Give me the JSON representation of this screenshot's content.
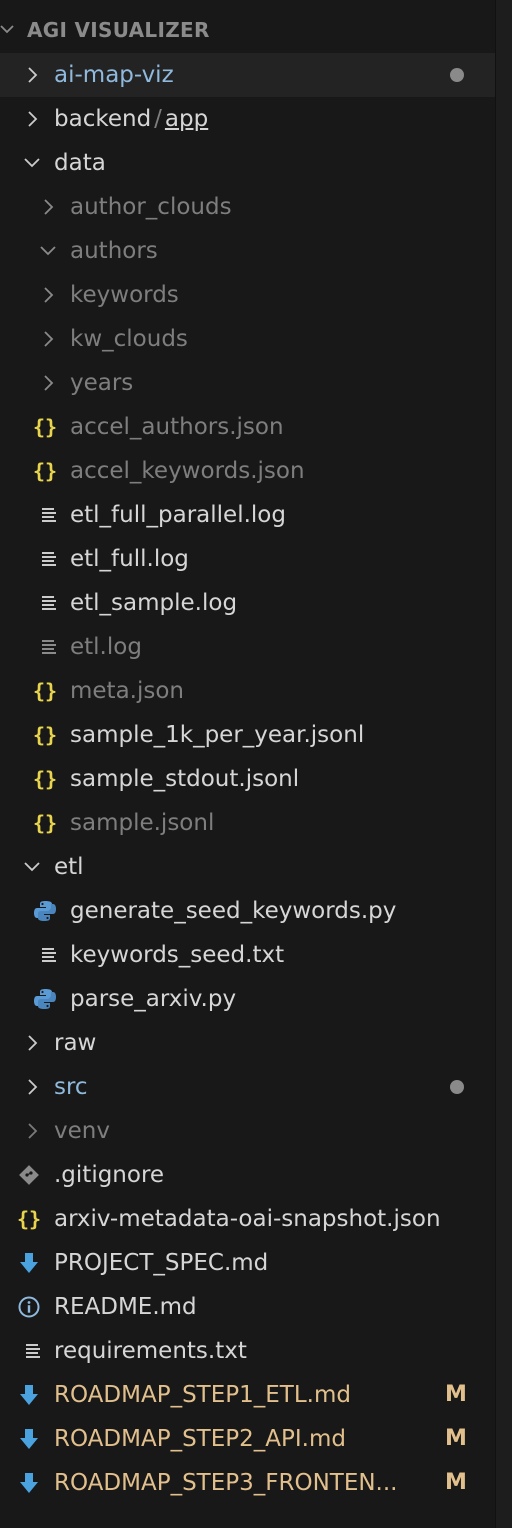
{
  "explorer": {
    "section_title": "AGI VISUALIZER"
  },
  "colors": {
    "json_icon": "#e8d44d",
    "python_icon": "#5b9bd5",
    "markdown_icon": "#4aa3df",
    "git_icon": "#8a8a8a",
    "modified": "#e2c08d",
    "folder_highlight": "#8fb9dd",
    "background": "#181818"
  },
  "tree": [
    {
      "label": "ai-map-viz",
      "type": "folder",
      "state": "collapsed",
      "dot": true
    },
    {
      "label": "backend",
      "sep": "/",
      "label2": "app",
      "type": "folder",
      "state": "collapsed"
    },
    {
      "label": "data",
      "type": "folder",
      "state": "expanded"
    },
    {
      "label": "author_clouds",
      "type": "folder",
      "state": "collapsed"
    },
    {
      "label": "authors",
      "type": "folder",
      "state": "expanded"
    },
    {
      "label": "keywords",
      "type": "folder",
      "state": "collapsed"
    },
    {
      "label": "kw_clouds",
      "type": "folder",
      "state": "collapsed"
    },
    {
      "label": "years",
      "type": "folder",
      "state": "collapsed"
    },
    {
      "label": "accel_authors.json",
      "type": "file",
      "icon": "json-icon"
    },
    {
      "label": "accel_keywords.json",
      "type": "file",
      "icon": "json-icon"
    },
    {
      "label": "etl_full_parallel.log",
      "type": "file",
      "icon": "text-file-icon"
    },
    {
      "label": "etl_full.log",
      "type": "file",
      "icon": "text-file-icon"
    },
    {
      "label": "etl_sample.log",
      "type": "file",
      "icon": "text-file-icon"
    },
    {
      "label": "etl.log",
      "type": "file",
      "icon": "text-file-icon"
    },
    {
      "label": "meta.json",
      "type": "file",
      "icon": "json-icon"
    },
    {
      "label": "sample_1k_per_year.jsonl",
      "type": "file",
      "icon": "json-icon"
    },
    {
      "label": "sample_stdout.jsonl",
      "type": "file",
      "icon": "json-icon"
    },
    {
      "label": "sample.jsonl",
      "type": "file",
      "icon": "json-icon"
    },
    {
      "label": "etl",
      "type": "folder",
      "state": "expanded"
    },
    {
      "label": "generate_seed_keywords.py",
      "type": "file",
      "icon": "python-icon"
    },
    {
      "label": "keywords_seed.txt",
      "type": "file",
      "icon": "text-file-icon"
    },
    {
      "label": "parse_arxiv.py",
      "type": "file",
      "icon": "python-icon"
    },
    {
      "label": "raw",
      "type": "folder",
      "state": "collapsed"
    },
    {
      "label": "src",
      "type": "folder",
      "state": "collapsed",
      "dot": true
    },
    {
      "label": "venv",
      "type": "folder",
      "state": "collapsed"
    },
    {
      "label": ".gitignore",
      "type": "file",
      "icon": "git-icon"
    },
    {
      "label": "arxiv-metadata-oai-snapshot.json",
      "type": "file",
      "icon": "json-icon"
    },
    {
      "label": "PROJECT_SPEC.md",
      "type": "file",
      "icon": "markdown-icon"
    },
    {
      "label": "README.md",
      "type": "file",
      "icon": "info-icon"
    },
    {
      "label": "requirements.txt",
      "type": "file",
      "icon": "text-file-icon"
    },
    {
      "label": "ROADMAP_STEP1_ETL.md",
      "type": "file",
      "icon": "markdown-icon",
      "badge": "M"
    },
    {
      "label": "ROADMAP_STEP2_API.md",
      "type": "file",
      "icon": "markdown-icon",
      "badge": "M"
    },
    {
      "label": "ROADMAP_STEP3_FRONTEN...",
      "type": "file",
      "icon": "markdown-icon",
      "badge": "M"
    }
  ]
}
